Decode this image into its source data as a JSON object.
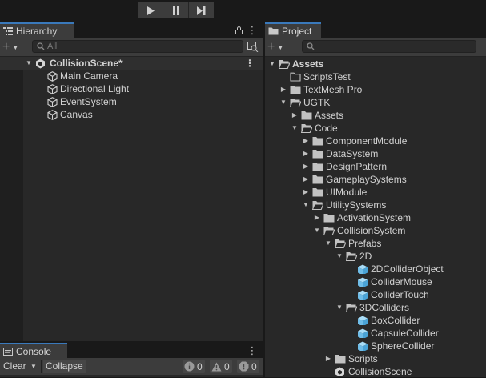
{
  "toolbar": {
    "buttons": [
      "play",
      "pause",
      "step"
    ]
  },
  "hierarchy": {
    "tab_label": "Hierarchy",
    "search_placeholder": "All",
    "scene_name": "CollisionScene*",
    "items": [
      "Main Camera",
      "Directional Light",
      "EventSystem",
      "Canvas"
    ]
  },
  "console": {
    "tab_label": "Console",
    "clear_label": "Clear",
    "collapse_label": "Collapse",
    "info_count": "0",
    "warning_count": "0",
    "error_count": "0"
  },
  "project": {
    "tab_label": "Project",
    "search_placeholder": "",
    "tree": [
      {
        "label": "Assets",
        "depth": 0,
        "arrow": "open",
        "icon": "folder-open-icon",
        "bold": true
      },
      {
        "label": "ScriptsTest",
        "depth": 1,
        "arrow": "none",
        "icon": "folder-empty-icon"
      },
      {
        "label": "TextMesh Pro",
        "depth": 1,
        "arrow": "closed",
        "icon": "folder-icon"
      },
      {
        "label": "UGTK",
        "depth": 1,
        "arrow": "open",
        "icon": "folder-open-icon"
      },
      {
        "label": "Assets",
        "depth": 2,
        "arrow": "closed",
        "icon": "folder-icon"
      },
      {
        "label": "Code",
        "depth": 2,
        "arrow": "open",
        "icon": "folder-open-icon"
      },
      {
        "label": "ComponentModule",
        "depth": 3,
        "arrow": "closed",
        "icon": "folder-icon"
      },
      {
        "label": "DataSystem",
        "depth": 3,
        "arrow": "closed",
        "icon": "folder-icon"
      },
      {
        "label": "DesignPattern",
        "depth": 3,
        "arrow": "closed",
        "icon": "folder-icon"
      },
      {
        "label": "GameplaySystems",
        "depth": 3,
        "arrow": "closed",
        "icon": "folder-icon"
      },
      {
        "label": "UIModule",
        "depth": 3,
        "arrow": "closed",
        "icon": "folder-icon"
      },
      {
        "label": "UtilitySystems",
        "depth": 3,
        "arrow": "open",
        "icon": "folder-open-icon"
      },
      {
        "label": "ActivationSystem",
        "depth": 4,
        "arrow": "closed",
        "icon": "folder-icon"
      },
      {
        "label": "CollisionSystem",
        "depth": 4,
        "arrow": "open",
        "icon": "folder-open-icon"
      },
      {
        "label": "Prefabs",
        "depth": 5,
        "arrow": "open",
        "icon": "folder-open-icon"
      },
      {
        "label": "2D",
        "depth": 6,
        "arrow": "open",
        "icon": "folder-open-icon"
      },
      {
        "label": "2DColliderObject",
        "depth": 7,
        "arrow": "none",
        "icon": "prefab-cube-icon"
      },
      {
        "label": "ColliderMouse",
        "depth": 7,
        "arrow": "none",
        "icon": "prefab-cube-icon"
      },
      {
        "label": "ColliderTouch",
        "depth": 7,
        "arrow": "none",
        "icon": "prefab-cube-icon"
      },
      {
        "label": "3DColliders",
        "depth": 6,
        "arrow": "open",
        "icon": "folder-open-icon"
      },
      {
        "label": "BoxCollider",
        "depth": 7,
        "arrow": "none",
        "icon": "prefab-cube-icon"
      },
      {
        "label": "CapsuleCollider",
        "depth": 7,
        "arrow": "none",
        "icon": "prefab-cube-icon"
      },
      {
        "label": "SphereCollider",
        "depth": 7,
        "arrow": "none",
        "icon": "prefab-cube-icon"
      },
      {
        "label": "Scripts",
        "depth": 5,
        "arrow": "closed",
        "icon": "folder-icon"
      },
      {
        "label": "CollisionScene",
        "depth": 5,
        "arrow": "none",
        "icon": "unity-scene-icon"
      }
    ]
  },
  "colors": {
    "accent_tab": "#3a79bb",
    "prefab_blue": "#7cc7f0",
    "panel_bg": "#282828",
    "bar_bg": "#3c3c3c"
  }
}
